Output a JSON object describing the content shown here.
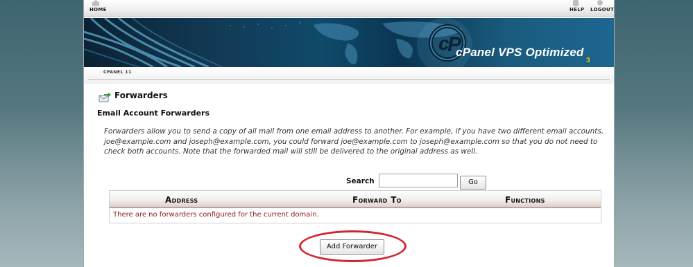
{
  "topbar": {
    "home_label": "HOME",
    "help_label": "HELP",
    "logout_label": "LOGOUT"
  },
  "banner": {
    "brand_name": "cPanel",
    "brand_suffix": "VPS Optimized",
    "brand_version": "3"
  },
  "version_label": "CPANEL 11",
  "page": {
    "title": "Forwarders",
    "section_title": "Email Account Forwarders",
    "description": "Forwarders allow you to send a copy of all mail from one email address to another. For example, if you have two different email accounts, joe@example.com and joseph@example.com, you could forward joe@example.com to joseph@example.com so that you do not need to check both accounts. Note that the forwarded mail will still be delivered to the original address as well."
  },
  "search": {
    "label": "Search",
    "value": "",
    "go_label": "Go"
  },
  "table": {
    "columns": [
      "Address",
      "Forward To",
      "Functions"
    ],
    "empty_message": "There are no forwarders configured for the current domain."
  },
  "actions": {
    "add_forwarder_label": "Add Forwarder"
  },
  "colors": {
    "highlight": "#d4252b",
    "empty_message": "#8b1a1a",
    "brand_accent": "#f2c200"
  }
}
